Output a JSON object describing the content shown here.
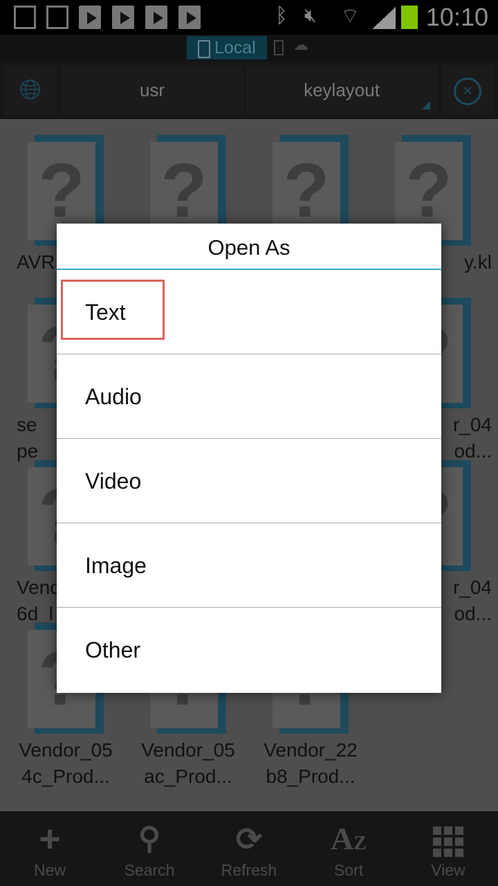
{
  "status_bar": {
    "time": "10:10",
    "icons": [
      "sd-card-icon",
      "gallery-icon",
      "play-store-icon",
      "play-store-icon",
      "play-store-icon",
      "play-store-icon",
      "bluetooth-icon",
      "mute-icon",
      "wifi-icon",
      "signal-icon",
      "battery-icon"
    ],
    "battery_color": "#7ec400"
  },
  "location_tabs": {
    "active": "Local",
    "icons": [
      "phone-icon",
      "network-icon",
      "cloud-icon"
    ]
  },
  "breadcrumb": [
    "usr",
    "keylayout"
  ],
  "files": [
    {
      "label": "AVR"
    },
    {
      "label": ""
    },
    {
      "label": ""
    },
    {
      "label": "y.kl"
    },
    {
      "label": "se\npe"
    },
    {
      "label": ""
    },
    {
      "label": ""
    },
    {
      "label": "r_04\nod..."
    },
    {
      "label": "Venc\n6d_l"
    },
    {
      "label": ""
    },
    {
      "label": ""
    },
    {
      "label": "r_04\nod..."
    },
    {
      "label": "Vendor_05\n4c_Prod..."
    },
    {
      "label": "Vendor_05\nac_Prod..."
    },
    {
      "label": "Vendor_22\nb8_Prod..."
    }
  ],
  "dialog": {
    "title": "Open As",
    "items": [
      "Text",
      "Audio",
      "Video",
      "Image",
      "Other"
    ],
    "highlighted": "Text",
    "highlight_color": "#d9645b",
    "accent": "#3aa7c9"
  },
  "bottom_bar": [
    {
      "label": "New",
      "icon": "plus-icon"
    },
    {
      "label": "Search",
      "icon": "search-icon"
    },
    {
      "label": "Refresh",
      "icon": "refresh-icon"
    },
    {
      "label": "Sort",
      "icon": "sort-az-icon"
    },
    {
      "label": "View",
      "icon": "grid-view-icon"
    }
  ]
}
